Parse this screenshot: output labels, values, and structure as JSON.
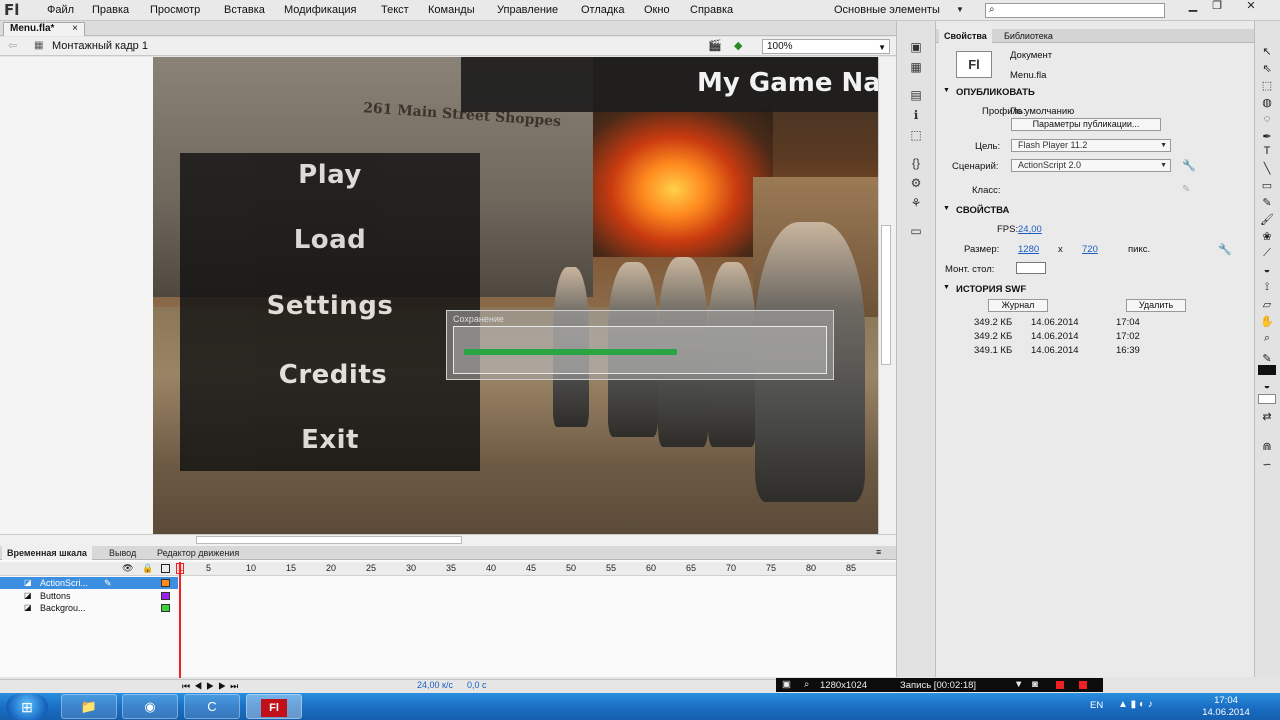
{
  "app": {
    "logo": "Fl"
  },
  "menu": [
    "Файл",
    "Правка",
    "Просмотр",
    "Вставка",
    "Модификация",
    "Текст",
    "Команды",
    "Управление",
    "Отладка",
    "Окно",
    "Справка"
  ],
  "workspace": {
    "label": "Основные элементы",
    "search_placeholder": ""
  },
  "document": {
    "tab": "Menu.fla*",
    "tab_close": "×",
    "scene": "Монтажный кадр 1",
    "zoom": "100%"
  },
  "stage": {
    "game_title": "My Game Nar",
    "street_sign": "261 Main Street Shoppes",
    "menu_items": [
      "Play",
      "Load",
      "Settings",
      "Credits",
      "Exit"
    ],
    "save_dialog": {
      "title": "Сохранение",
      "progress": 0.57
    }
  },
  "timeline": {
    "tabs": [
      "Временная шкала",
      "Вывод",
      "Редактор движения"
    ],
    "frame_numbers": [
      "1",
      "5",
      "10",
      "15",
      "20",
      "25",
      "30",
      "35",
      "40",
      "45",
      "50",
      "55",
      "60",
      "65",
      "70",
      "75",
      "80",
      "85"
    ],
    "layers": [
      "ActionScri...",
      "Buttons",
      "Backgrou..."
    ],
    "layer_colors": [
      "#ff8c1a",
      "#a020f0",
      "#3ad13a"
    ],
    "fps": "24,00 к/с",
    "time": "0,0 с",
    "current_frame": "1"
  },
  "properties": {
    "tabs": [
      "Свойства",
      "Библиотека"
    ],
    "doc_icon": "Fl",
    "doc_type": "Документ",
    "doc_name": "Menu.fla",
    "publish": {
      "section": "ОПУБЛИКОВАТЬ",
      "profile_label": "Профиль:",
      "profile_value": "По умолчанию",
      "publish_settings_button": "Параметры публикации...",
      "target_label": "Цель:",
      "target_value": "Flash Player 11.2",
      "script_label": "Сценарий:",
      "script_value": "ActionScript 2.0",
      "class_label": "Класс:"
    },
    "props": {
      "section": "СВОЙСТВА",
      "fps_label": "FPS:",
      "fps_value": "24,00",
      "size_label": "Размер:",
      "width": "1280",
      "x_sep": "x",
      "height": "720",
      "unit": "пикс.",
      "stage_label": "Монт. стол:",
      "stage_color": "#ffffff"
    },
    "swf_history": {
      "section": "ИСТОРИЯ SWF",
      "log_button": "Журнал",
      "delete_button": "Удалить",
      "entries": [
        {
          "size": "349.2 КБ",
          "date": "14.06.2014",
          "time": "17:04"
        },
        {
          "size": "349.2 КБ",
          "date": "14.06.2014",
          "time": "17:02"
        },
        {
          "size": "349.1 КБ",
          "date": "14.06.2014",
          "time": "16:39"
        }
      ]
    }
  },
  "recorder": {
    "resolution": "1280x1024",
    "status": "Запись [00:02:18]"
  },
  "taskbar": {
    "lang": "EN",
    "time": "17:04",
    "date": "14.06.2014"
  }
}
